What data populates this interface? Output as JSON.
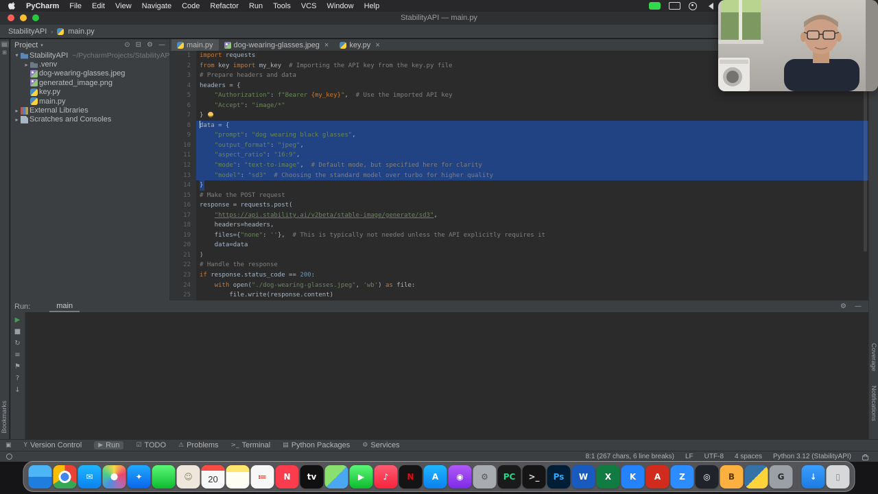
{
  "menu_bar": {
    "items": [
      "PyCharm",
      "File",
      "Edit",
      "View",
      "Navigate",
      "Code",
      "Refactor",
      "Run",
      "Tools",
      "VCS",
      "Window",
      "Help"
    ]
  },
  "window": {
    "title": "StabilityAPI — main.py"
  },
  "nav_bar": {
    "project": "StabilityAPI",
    "separator": "›",
    "file": "main.py"
  },
  "left_stripe": {
    "icons": [
      {
        "name": "project-stripe-icon",
        "glyph": "▤",
        "active": true
      },
      {
        "name": "structure-stripe-icon",
        "glyph": "⊞",
        "active": false
      }
    ],
    "bottom_label": "Bookmarks"
  },
  "project_panel": {
    "title": "Project",
    "caret": "▾",
    "header_icons": [
      {
        "name": "locate-icon",
        "glyph": "⊙"
      },
      {
        "name": "collapse-all-icon",
        "glyph": "⊟"
      },
      {
        "name": "settings-icon",
        "glyph": "⚙"
      },
      {
        "name": "hide-icon",
        "glyph": "—"
      }
    ],
    "tree": [
      {
        "label": "StabilityAPI",
        "path": "~/PycharmProjects/StabilityAPI",
        "icon": "project-folder",
        "indent": 0,
        "arrow": "▾"
      },
      {
        "label": ".venv",
        "icon": "folder",
        "indent": 1,
        "arrow": "▸"
      },
      {
        "label": "dog-wearing-glasses.jpeg",
        "icon": "image-file",
        "indent": 1,
        "arrow": ""
      },
      {
        "label": "generated_image.png",
        "icon": "image-file",
        "indent": 1,
        "arrow": ""
      },
      {
        "label": "key.py",
        "icon": "python-file",
        "indent": 1,
        "arrow": ""
      },
      {
        "label": "main.py",
        "icon": "python-file",
        "indent": 1,
        "arrow": ""
      },
      {
        "label": "External Libraries",
        "icon": "libraries",
        "indent": 0,
        "arrow": "▸"
      },
      {
        "label": "Scratches and Consoles",
        "icon": "scratches",
        "indent": 0,
        "arrow": "▸"
      }
    ]
  },
  "editor": {
    "tabs": [
      {
        "label": "main.py",
        "icon": "python-file",
        "active": true,
        "close": ""
      },
      {
        "label": "dog-wearing-glasses.jpeg",
        "icon": "image-file",
        "active": false,
        "close": "×"
      },
      {
        "label": "key.py",
        "icon": "python-file",
        "active": false,
        "close": "×"
      }
    ],
    "code": [
      {
        "n": 1,
        "t": [
          [
            "kw",
            "import"
          ],
          [
            "pln",
            " requests"
          ]
        ]
      },
      {
        "n": 2,
        "t": [
          [
            "kw",
            "from"
          ],
          [
            "pln",
            " key "
          ],
          [
            "kw",
            "import"
          ],
          [
            "pln",
            " my_key  "
          ],
          [
            "com",
            "# Importing the API key from the key.py file"
          ]
        ]
      },
      {
        "n": 3,
        "t": [
          [
            "com",
            "# Prepare headers and data"
          ]
        ]
      },
      {
        "n": 4,
        "t": [
          [
            "pln",
            "headers = {"
          ]
        ]
      },
      {
        "n": 5,
        "t": [
          [
            "pln",
            "    "
          ],
          [
            "str",
            "\"Authorization\""
          ],
          [
            "pln",
            ": "
          ],
          [
            "str",
            "f\"Bearer "
          ],
          [
            "itp",
            "{my_key}"
          ],
          [
            "str",
            "\""
          ],
          [
            "pln",
            ",  "
          ],
          [
            "com",
            "# Use the imported API key"
          ]
        ]
      },
      {
        "n": 6,
        "t": [
          [
            "pln",
            "    "
          ],
          [
            "str",
            "\"Accept\""
          ],
          [
            "pln",
            ": "
          ],
          [
            "str",
            "\"image/*\""
          ]
        ]
      },
      {
        "n": 7,
        "bulb": true,
        "t": [
          [
            "pln",
            "}"
          ]
        ]
      },
      {
        "n": 8,
        "sel": true,
        "caret": true,
        "t": [
          [
            "pln",
            "data = {"
          ]
        ]
      },
      {
        "n": 9,
        "sel": true,
        "t": [
          [
            "pln",
            "    "
          ],
          [
            "str",
            "\"prompt\""
          ],
          [
            "pln",
            ": "
          ],
          [
            "str",
            "\"dog wearing black glasses\""
          ],
          [
            "pln",
            ","
          ]
        ]
      },
      {
        "n": 10,
        "sel": true,
        "t": [
          [
            "pln",
            "    "
          ],
          [
            "str",
            "\"output_format\""
          ],
          [
            "pln",
            ": "
          ],
          [
            "str",
            "\"jpeg\""
          ],
          [
            "pln",
            ","
          ]
        ]
      },
      {
        "n": 11,
        "sel": true,
        "t": [
          [
            "pln",
            "    "
          ],
          [
            "str",
            "\"aspect_ratio\""
          ],
          [
            "pln",
            ": "
          ],
          [
            "str",
            "\"16:9\""
          ],
          [
            "pln",
            ","
          ]
        ]
      },
      {
        "n": 12,
        "sel": true,
        "t": [
          [
            "pln",
            "    "
          ],
          [
            "str",
            "\"mode\""
          ],
          [
            "pln",
            ": "
          ],
          [
            "str",
            "\"text-to-image\""
          ],
          [
            "pln",
            ",  "
          ],
          [
            "com",
            "# Default mode, but specified here for clarity"
          ]
        ]
      },
      {
        "n": 13,
        "sel": true,
        "t": [
          [
            "pln",
            "    "
          ],
          [
            "str",
            "\"model\""
          ],
          [
            "pln",
            ": "
          ],
          [
            "str",
            "\"sd3\""
          ],
          [
            "pln",
            "  "
          ],
          [
            "com",
            "# Choosing the standard model over turbo for higher quality"
          ]
        ]
      },
      {
        "n": 14,
        "selPart": true,
        "t": [
          [
            "pln",
            "}"
          ]
        ]
      },
      {
        "n": 15,
        "t": [
          [
            "com",
            "# Make the POST request"
          ]
        ]
      },
      {
        "n": 16,
        "t": [
          [
            "pln",
            "response = requests.post("
          ]
        ]
      },
      {
        "n": 17,
        "t": [
          [
            "pln",
            "    "
          ],
          [
            "url",
            "\"https://api.stability.ai/v2beta/stable-image/generate/sd3\""
          ],
          [
            "pln",
            ","
          ]
        ]
      },
      {
        "n": 18,
        "t": [
          [
            "pln",
            "    headers=headers,"
          ]
        ]
      },
      {
        "n": 19,
        "t": [
          [
            "pln",
            "    files={"
          ],
          [
            "str",
            "\"none\""
          ],
          [
            "pln",
            ": "
          ],
          [
            "str",
            "''"
          ],
          [
            "pln",
            "},  "
          ],
          [
            "com",
            "# This is typically not needed unless the API explicitly requires it"
          ]
        ]
      },
      {
        "n": 20,
        "t": [
          [
            "pln",
            "    data=data"
          ]
        ]
      },
      {
        "n": 21,
        "t": [
          [
            "pln",
            ")"
          ]
        ]
      },
      {
        "n": 22,
        "t": [
          [
            "com",
            "# Handle the response"
          ]
        ]
      },
      {
        "n": 23,
        "t": [
          [
            "kw",
            "if"
          ],
          [
            "pln",
            " response.status_code == "
          ],
          [
            "num",
            "200"
          ],
          [
            "pln",
            ":"
          ]
        ]
      },
      {
        "n": 24,
        "t": [
          [
            "pln",
            "    "
          ],
          [
            "kw",
            "with"
          ],
          [
            "pln",
            " open("
          ],
          [
            "str",
            "\"./dog-wearing-glasses.jpeg\""
          ],
          [
            "pln",
            ", "
          ],
          [
            "str",
            "'wb'"
          ],
          [
            "pln",
            ") "
          ],
          [
            "kw",
            "as"
          ],
          [
            "pln",
            " file:"
          ]
        ]
      },
      {
        "n": 25,
        "t": [
          [
            "pln",
            "        file.write(response.content)"
          ]
        ]
      }
    ]
  },
  "run_panel": {
    "label": "Run:",
    "tab": "main",
    "toolbar_icons": [
      {
        "name": "rerun-icon",
        "glyph": "▶",
        "color": "#499c54"
      },
      {
        "name": "stop-icon",
        "glyph": "■",
        "color": "#9aa0a6"
      },
      {
        "name": "restore-layout-icon",
        "glyph": "↻",
        "color": "#9aa0a6"
      },
      {
        "name": "history-icon",
        "glyph": "≡",
        "color": "#9aa0a6"
      },
      {
        "name": "pin-icon",
        "glyph": "⚑",
        "color": "#9aa0a6"
      },
      {
        "name": "help-icon",
        "glyph": "?",
        "color": "#9aa0a6"
      },
      {
        "name": "scroll-to-end-icon",
        "glyph": "↓",
        "color": "#9aa0a6"
      }
    ],
    "header_icons": [
      {
        "name": "settings-icon",
        "glyph": "⚙"
      },
      {
        "name": "hide-icon",
        "glyph": "—"
      }
    ]
  },
  "toolwindow_bar": {
    "switcher_glyph": "▣",
    "items": [
      {
        "label": "Version Control",
        "icon": "version-control-icon",
        "glyph": "Y",
        "active": false
      },
      {
        "label": "Run",
        "icon": "run-icon",
        "glyph": "▶",
        "active": true
      },
      {
        "label": "TODO",
        "icon": "todo-icon",
        "glyph": "☑",
        "active": false
      },
      {
        "label": "Problems",
        "icon": "problems-icon",
        "glyph": "⚠",
        "active": false
      },
      {
        "label": "Terminal",
        "icon": "terminal-icon",
        "glyph": ">_",
        "active": false
      },
      {
        "label": "Python Packages",
        "icon": "python-packages-icon",
        "glyph": "▤",
        "active": false
      },
      {
        "label": "Services",
        "icon": "services-icon",
        "glyph": "⚙",
        "active": false
      }
    ]
  },
  "status_bar": {
    "caret": "8:1 (267 chars, 6 line breaks)",
    "line_sep": "LF",
    "encoding": "UTF-8",
    "indent": "4 spaces",
    "interpreter": "Python 3.12 (StabilityAPI)"
  },
  "side_labels": {
    "left_bottom": "Bookmarks",
    "right_mid": "Coverage",
    "right_bottom": "Notifications"
  },
  "dock": {
    "items": [
      {
        "name": "finder",
        "style": "linear-gradient(180deg,#4db5f5 50%,#1f7ddd 50%)"
      },
      {
        "name": "chrome",
        "style": "radial-gradient(circle at center,#4285f4 0 6px,#fff 6px 9px,transparent 9px),conic-gradient(#ea4335 0 33%,#34a853 33% 66%,#fbbc05 66%)"
      },
      {
        "name": "mail",
        "style": "linear-gradient(180deg,#1fb6ff,#0a82ef)",
        "glyph": "✉"
      },
      {
        "name": "photos",
        "style": "radial-gradient(circle at center,#fff 0 5px,transparent 5px),conic-gradient(#f6d743,#ef476f,#b06ab3,#4a90e2,#4acf8c,#f6d743)"
      },
      {
        "name": "safari",
        "style": "linear-gradient(180deg,#21a9ff,#0a65e8)",
        "glyph": "✦"
      },
      {
        "name": "messages",
        "style": "linear-gradient(180deg,#5cf777,#0dbc2e)"
      },
      {
        "name": "contacts",
        "style": "#efe7dc",
        "glyph": "☺",
        "fg": "#8a7a66"
      },
      {
        "name": "calendar",
        "type": "calendar",
        "day": "20"
      },
      {
        "name": "notes",
        "style": "linear-gradient(180deg,#ffe66e 30%,#fffef2 30%)"
      },
      {
        "name": "reminders",
        "style": "#f7f7f7",
        "glyph": "≔",
        "fg": "#e8453c"
      },
      {
        "name": "news",
        "style": "#fa3c4c",
        "glyph": "N"
      },
      {
        "name": "tv",
        "style": "#101010",
        "glyph": "tv"
      },
      {
        "name": "maps",
        "style": "linear-gradient(135deg,#8ae06e 50%,#4aa8f0 50%)"
      },
      {
        "name": "facetime",
        "style": "linear-gradient(180deg,#5cf777,#0dbc2e)",
        "glyph": "▶"
      },
      {
        "name": "music",
        "style": "linear-gradient(180deg,#fb5c74,#fa233b)",
        "glyph": "♪"
      },
      {
        "name": "netflix",
        "style": "#141414",
        "glyph": "N",
        "fg": "#e50914"
      },
      {
        "name": "appstore",
        "style": "linear-gradient(180deg,#1fb6ff,#0a82ef)",
        "glyph": "A"
      },
      {
        "name": "podcasts",
        "style": "linear-gradient(180deg,#b05af7,#7d2ae8)",
        "glyph": "◉"
      },
      {
        "name": "settings",
        "style": "#a8abb0",
        "glyph": "⚙",
        "fg": "#555555"
      },
      {
        "name": "pycharm",
        "style": "#1a1a1a",
        "glyph": "PC",
        "fg": "#21d789"
      },
      {
        "name": "terminal",
        "style": "#151515",
        "glyph": ">_",
        "fg": "#dddddd"
      },
      {
        "name": "photoshop",
        "style": "#001e36",
        "glyph": "Ps",
        "fg": "#31a8ff"
      },
      {
        "name": "word",
        "style": "#185abd",
        "glyph": "W"
      },
      {
        "name": "excel",
        "style": "#107c41",
        "glyph": "X"
      },
      {
        "name": "keynote",
        "style": "#2483fa",
        "glyph": "K"
      },
      {
        "name": "pdf",
        "style": "#d12b1e",
        "glyph": "A"
      },
      {
        "name": "zoom",
        "style": "#2d8cff",
        "glyph": "Z"
      },
      {
        "name": "obs",
        "style": "#20242a",
        "glyph": "◎"
      },
      {
        "name": "homebrew",
        "style": "#fbb040",
        "glyph": "B",
        "fg": "#5d3a00"
      },
      {
        "name": "python",
        "style": "linear-gradient(135deg,#3572a5 50%,#ffd43b 50%)"
      },
      {
        "name": "github",
        "style": "#9aa0a6",
        "glyph": "G",
        "fg": "#2b2b2b"
      },
      {
        "type": "sep"
      },
      {
        "name": "downloads",
        "style": "linear-gradient(180deg,#3aa0ff,#1c7ae0)",
        "glyph": "↓"
      },
      {
        "name": "trash",
        "style": "#d6d8da",
        "glyph": "▯",
        "fg": "#888888"
      }
    ]
  }
}
